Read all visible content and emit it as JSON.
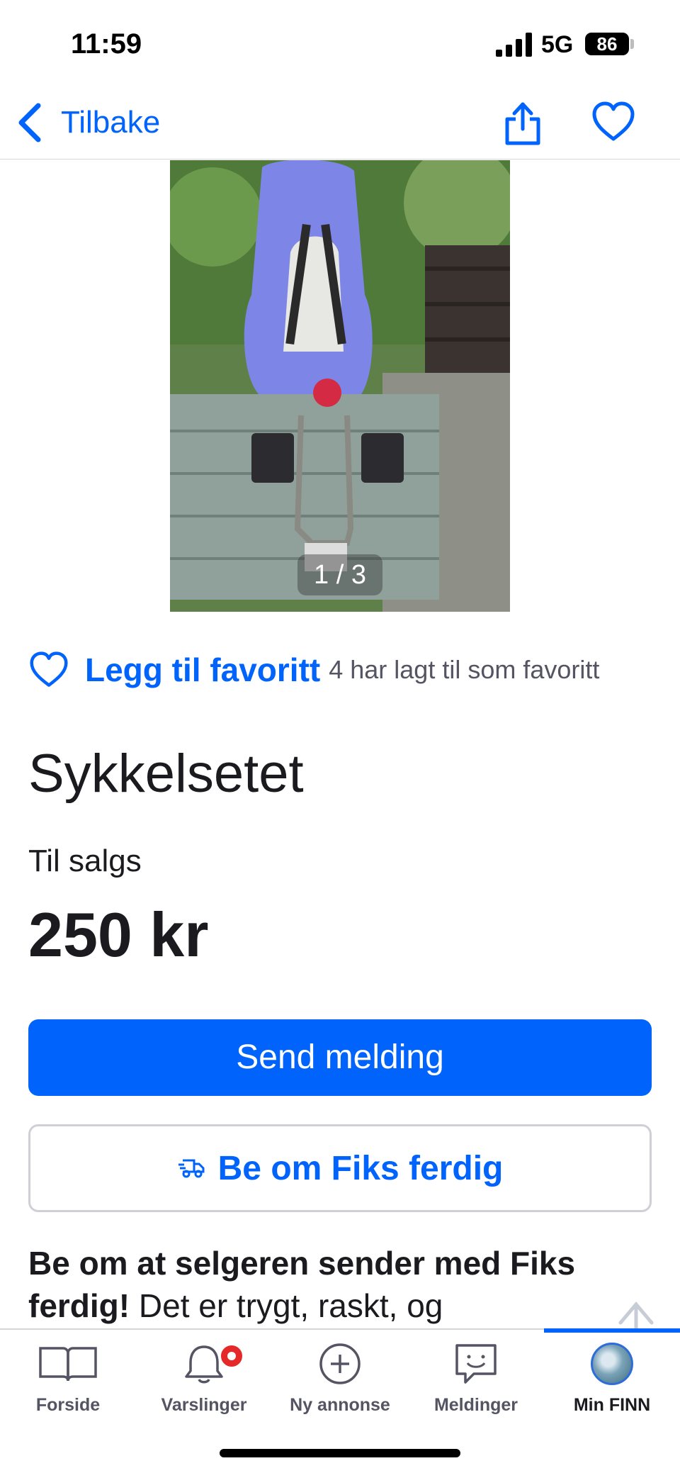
{
  "status_bar": {
    "time": "11:59",
    "network": "5G",
    "battery": "86"
  },
  "nav": {
    "back_label": "Tilbake",
    "share_icon": "share-icon",
    "favorite_icon": "heart-icon"
  },
  "gallery": {
    "counter": "1 / 3",
    "current": 1,
    "total": 3
  },
  "favorite": {
    "label": "Legg til favoritt",
    "count_text": "4 har lagt til som favoritt"
  },
  "listing": {
    "title": "Sykkelsetet",
    "status": "Til salgs",
    "price": "250 kr"
  },
  "actions": {
    "send_message": "Send melding",
    "fiks_ferdig": "Be om Fiks ferdig"
  },
  "promo": {
    "bold": "Be om at selgeren sender med Fiks ferdig!",
    "text": " Det er trygt, raskt, og"
  },
  "tabs": [
    {
      "label": "Forside",
      "icon": "book-icon"
    },
    {
      "label": "Varslinger",
      "icon": "bell-icon"
    },
    {
      "label": "Ny annonse",
      "icon": "plus-circle-icon"
    },
    {
      "label": "Meldinger",
      "icon": "chat-icon"
    },
    {
      "label": "Min FINN",
      "icon": "avatar"
    }
  ],
  "colors": {
    "accent": "#0063fb",
    "text": "#1b1b1f",
    "muted": "#545463",
    "badge": "#e52929"
  }
}
